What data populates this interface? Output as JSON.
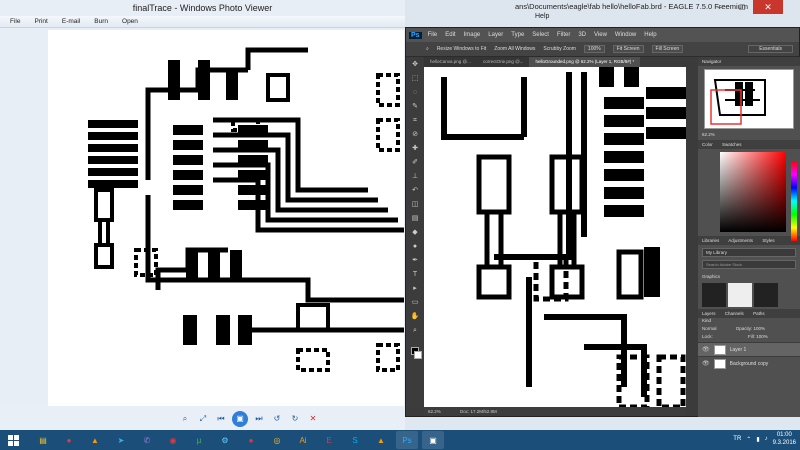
{
  "photo_viewer": {
    "title": "finalTrace - Windows Photo Viewer",
    "menu": [
      "File",
      "Print",
      "E-mail",
      "Burn",
      "Open"
    ],
    "controls": [
      "zoom-icon",
      "fit-icon",
      "prev-icon",
      "slideshow-icon",
      "next-icon",
      "rotate-left-icon",
      "rotate-right-icon",
      "delete-icon"
    ]
  },
  "eagle": {
    "title": "ans\\Documents\\eagle\\fab hello\\helloFab.brd - EAGLE 7.5.0 Freemium",
    "help": "Help"
  },
  "photoshop": {
    "logo": "Ps",
    "menu": [
      "File",
      "Edit",
      "Image",
      "Layer",
      "Type",
      "Select",
      "Filter",
      "3D",
      "View",
      "Window",
      "Help"
    ],
    "options": {
      "resize": "Resize Windows to Fit",
      "zoom_all": "Zoom All Windows",
      "scrubby": "Scrubby Zoom",
      "btn_100": "100%",
      "fit": "Fit Screen",
      "fill": "Fill Screen",
      "workspace": "Essentials"
    },
    "tabs": [
      "helloCanva.png @...",
      "correctOrie.png @...",
      "helloGrounded.png @ 62.2% (Layer 1, RGB/8#) *"
    ],
    "status": {
      "zoom": "62.2%",
      "doc": "Doc: 17.2M/52.8M"
    },
    "navigator": {
      "label": "Navigator",
      "zoom": "62.2%"
    },
    "color_tabs": [
      "Color",
      "Swatches"
    ],
    "libraries": {
      "tabs": [
        "Libraries",
        "Adjustments",
        "Styles"
      ],
      "current": "My Library",
      "search": "Search Adobe Stock",
      "section": "Graphics"
    },
    "layers": {
      "tabs": [
        "Layers",
        "Channels",
        "Paths"
      ],
      "kind": "Kind",
      "mode": "Normal",
      "opacity": "Opacity: 100%",
      "lock": "Lock:",
      "fill": "Fill: 100%",
      "items": [
        "Layer 1",
        "Background copy"
      ]
    }
  },
  "taskbar": {
    "lang": "TR",
    "time": "01:00",
    "date": "9.3.2016"
  },
  "colors": {
    "taskbar": "#1b4f7a",
    "ps_bg": "#3b3b3b",
    "wpv_bg": "#e8eef6"
  }
}
